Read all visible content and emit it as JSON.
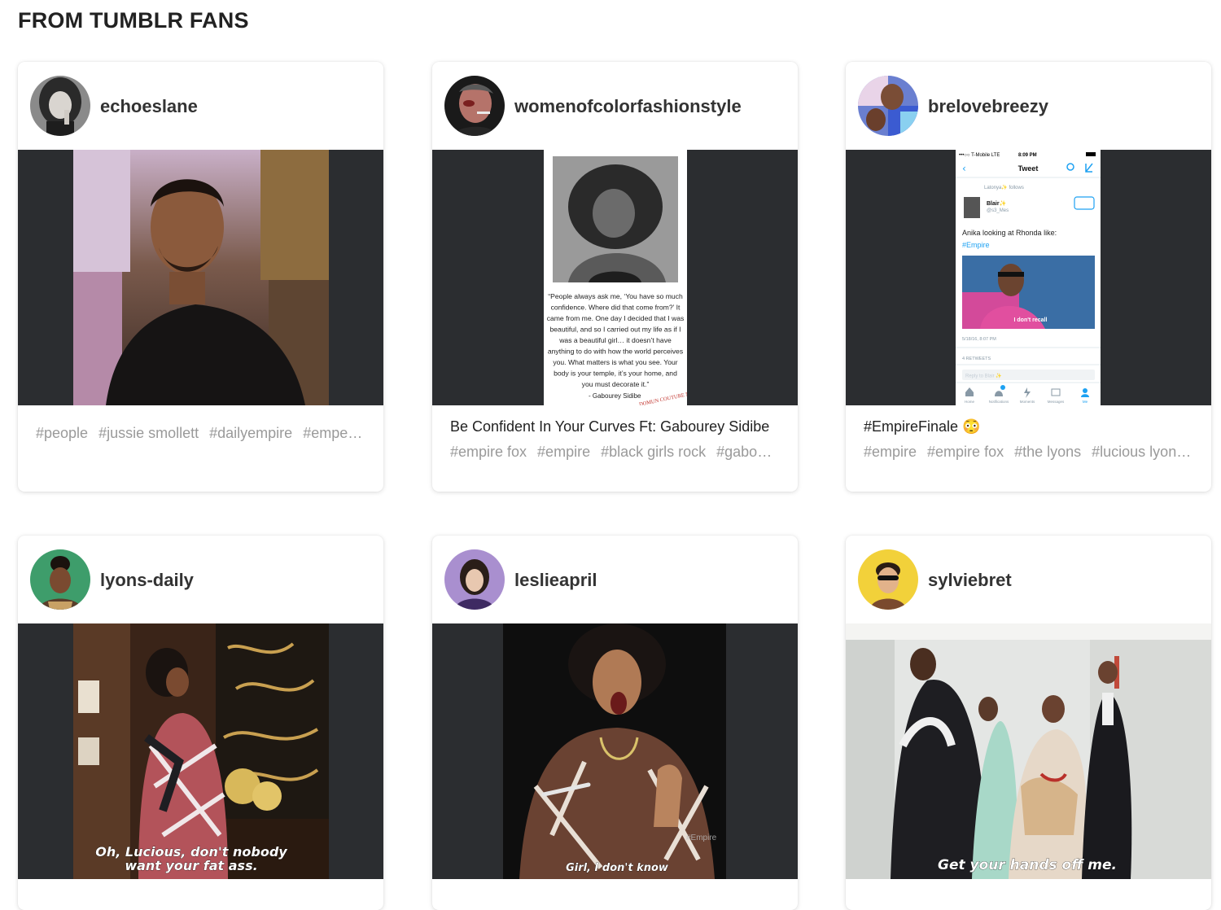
{
  "section_title": "FROM TUMBLR FANS",
  "cards": [
    {
      "username": "echoeslane",
      "title": "",
      "tags": [
        "#people",
        "#jussie smollett",
        "#dailyempire",
        "#empe…"
      ]
    },
    {
      "username": "womenofcolorfashionstyle",
      "title": "Be Confident In Your Curves Ft: Gabourey Sidibe",
      "tags": [
        "#empire fox",
        "#empire",
        "#black girls rock",
        "#gabo…"
      ],
      "quote": {
        "text": [
          "“People always ask me, ‘You have so much",
          "confidence. Where did that come from?’ It",
          "came from me. One day I decided that I was",
          "beautiful, and so I carried out my life as if I",
          "was a beautiful girl… it doesn’t have",
          "anything to do with how the world perceives",
          "you. What matters is what you see. Your",
          "body is your temple, it’s your home, and",
          "you must decorate it.”"
        ],
        "author": "- Gabourey Sidibe",
        "stamp": "DOMUN COUTURE NO"
      }
    },
    {
      "username": "brelovebreezy",
      "title": "#EmpireFinale 😳",
      "tags": [
        "#empire",
        "#empire fox",
        "#the lyons",
        "#lucious lyon…"
      ],
      "tweet": {
        "status_left": "•••○○ T-Mobile  LTE",
        "status_time": "8:09 PM",
        "header": "Tweet",
        "follows": "Latonya✨ follows",
        "name": "Blair✨",
        "handle": "@s3_Mes",
        "text": "Anika looking at Rhonda like:",
        "hashtag": "#Empire",
        "img_caption": "I don't recall",
        "date": "5/18/16, 8:07 PM",
        "retweets": "4 RETWEETS",
        "reply_placeholder": "Reply to Blair ✨",
        "tabs": [
          "Home",
          "Notifications",
          "Moments",
          "Messages",
          "Me"
        ]
      }
    },
    {
      "username": "lyons-daily",
      "title": "",
      "tags": [],
      "gif_caption": [
        "Oh, Lucious, don't nobody",
        "want your fat ass."
      ]
    },
    {
      "username": "leslieapril",
      "title": "",
      "tags": [],
      "gif_caption": [
        "Girl, I don't know"
      ],
      "watermark": "#Empire"
    },
    {
      "username": "sylviebret",
      "title": "",
      "tags": [],
      "gif_caption": [
        "Get your hands off me."
      ]
    }
  ]
}
